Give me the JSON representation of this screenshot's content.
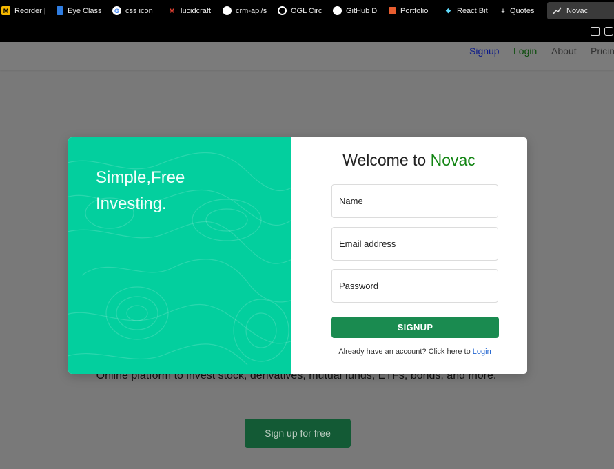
{
  "bookmarks": [
    {
      "label": "Reorder |",
      "icon": "reorder-icon",
      "color": "#f6b800"
    },
    {
      "label": "Eye Class",
      "icon": "flag-icon",
      "color": "#2f7de1"
    },
    {
      "label": "css icon",
      "icon": "google-icon",
      "color": "#ffffff"
    },
    {
      "label": "lucidcraft",
      "icon": "gmail-icon",
      "color": "#ea4335"
    },
    {
      "label": "crm-api/s",
      "icon": "github-icon",
      "color": "#ffffff"
    },
    {
      "label": "OGL Circ",
      "icon": "codepen-icon",
      "color": "#ffffff"
    },
    {
      "label": "GitHub D",
      "icon": "github-icon",
      "color": "#ffffff"
    },
    {
      "label": "Portfolio",
      "icon": "portfolio-icon",
      "color": "#e85d2f"
    },
    {
      "label": "React Bit",
      "icon": "react-bits-icon",
      "color": "#61dafb"
    },
    {
      "label": "Quotes",
      "icon": "quotes-icon",
      "color": "#cccccc"
    }
  ],
  "active_tab": {
    "label": "Novac",
    "icon": "chart-line-icon"
  },
  "nav": {
    "signup": "Signup",
    "login": "Login",
    "about": "About",
    "pricing": "Pricin"
  },
  "hero": {
    "description": "Online platform to invest stock, derivatives, mutual funds, ETFs, bonds, and more.",
    "cta": "Sign up for free"
  },
  "modal": {
    "tagline": "Simple,Free Investing.",
    "welcome_prefix": "Welcome to",
    "brand": "Novac",
    "name_placeholder": "Name",
    "email_placeholder": "Email address",
    "password_placeholder": "Password",
    "signup_label": "SIGNUP",
    "already_text": "Already have an account? Click here to",
    "login_link": "Login"
  },
  "colors": {
    "accent_green": "#03cf9e",
    "brand_green": "#128513",
    "button_green": "#1a8b50",
    "link_blue": "#2265d0"
  }
}
